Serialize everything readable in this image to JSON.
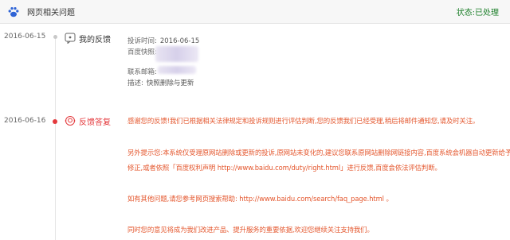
{
  "header": {
    "title": "网页相关问题",
    "status": "状态:已处理",
    "logo_icon": "baidu-paw-icon"
  },
  "feedback": {
    "date": "2016-06-15",
    "label": "我的反馈",
    "icon": "chat-bubble-icon",
    "fields": {
      "time_label": "投诉时间:",
      "time_value": "2016-06-15",
      "snapshot_label": "百度快照:",
      "contact_label": "联系邮箱:",
      "desc_label": "描述:",
      "desc_value": "快照删除与更新"
    }
  },
  "reply": {
    "date": "2016-06-16",
    "label": "反馈答复",
    "icon": "support-agent-icon",
    "accent_color": "#e4393c",
    "lines": [
      "感谢您的反馈!我们已根据相关法律规定和投诉规则进行评估判断,您的反馈我们已经受理,稍后将邮件通知您,请及时关注。",
      "另外提示您:本系统仅受理原网站删除或更新的投诉,原网站未变化的,建议您联系原网站删除网链接内容,百度系统会机器自动更新给予",
      "修正,或者依照「百度权利声明 http://www.baidu.com/duty/right.html」进行反馈,百度会依法评估判断。",
      "如有其他问题,请您参考网页搜索帮助: http://www.baidu.com/search/faq_page.html 。",
      "同时您的意见将成为我们改进产品、提升服务的重要依据,欢迎您继续关注支持我们。"
    ]
  }
}
